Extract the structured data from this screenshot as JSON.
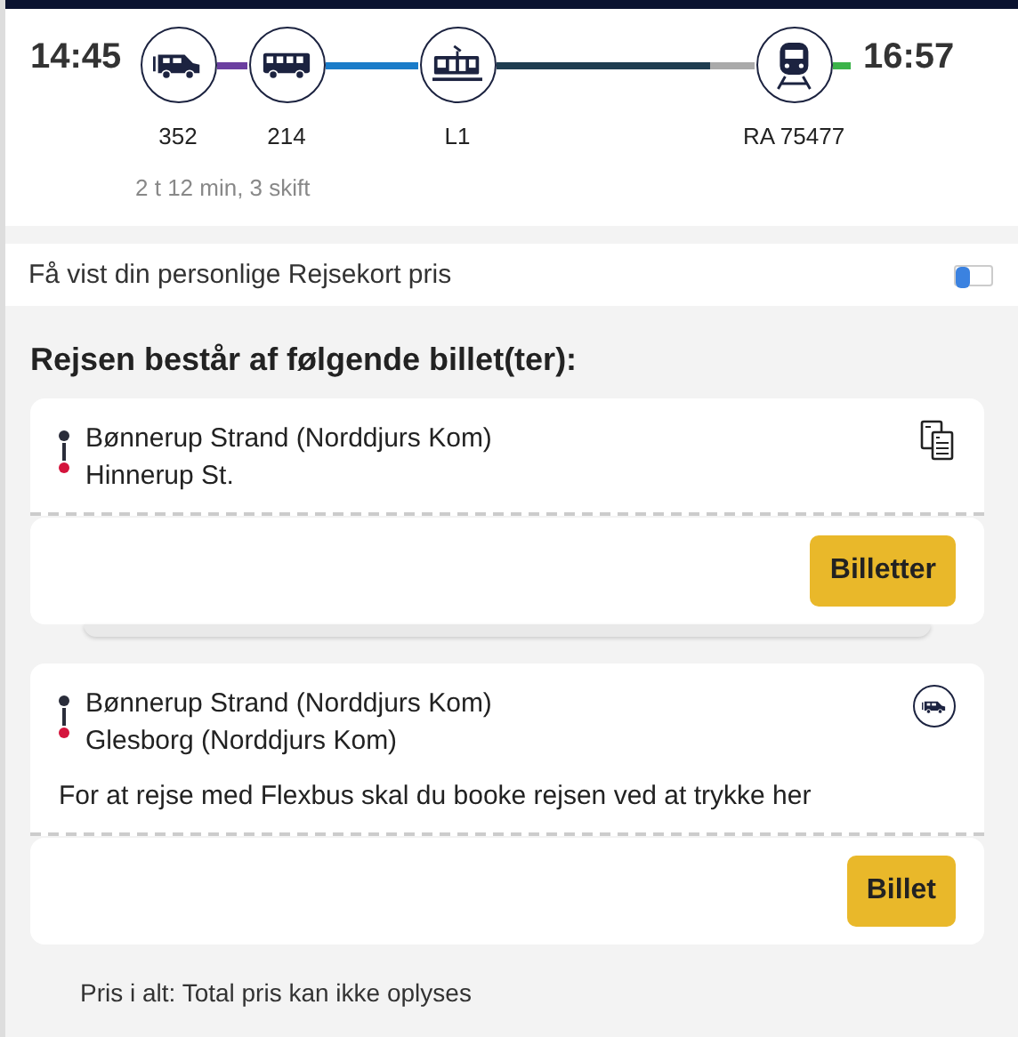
{
  "journey": {
    "departure": "14:45",
    "arrival": "16:57",
    "summary": "2 t 12 min, 3 skift",
    "legs": [
      {
        "kind": "van",
        "label": "352",
        "color": "#6b3fa0"
      },
      {
        "kind": "bus",
        "label": "214",
        "color": "#1a7cc9"
      },
      {
        "kind": "tram",
        "label": "L1",
        "color": "#1f3d50"
      },
      {
        "kind": "walk",
        "color": "#aaaaaa"
      },
      {
        "kind": "train",
        "label": "RA 75477",
        "color": "#3cb34a"
      }
    ]
  },
  "rejsekort": {
    "label": "Få vist din personlige Rejsekort pris",
    "on": false
  },
  "tickets_heading": "Rejsen består af følgende billet(ter):",
  "tickets": [
    {
      "kind": "documents",
      "from": "Bønnerup Strand (Norddjurs Kom)",
      "to": "Hinnerup St.",
      "button": "Billetter",
      "stacked": true
    },
    {
      "kind": "van",
      "from": "Bønnerup Strand (Norddjurs Kom)",
      "to": "Glesborg (Norddjurs Kom)",
      "note": "For at rejse med Flexbus skal du booke rejsen ved at trykke her",
      "button": "Billet",
      "stacked": false
    }
  ],
  "total": "Pris i alt: Total pris kan ikke oplyses"
}
